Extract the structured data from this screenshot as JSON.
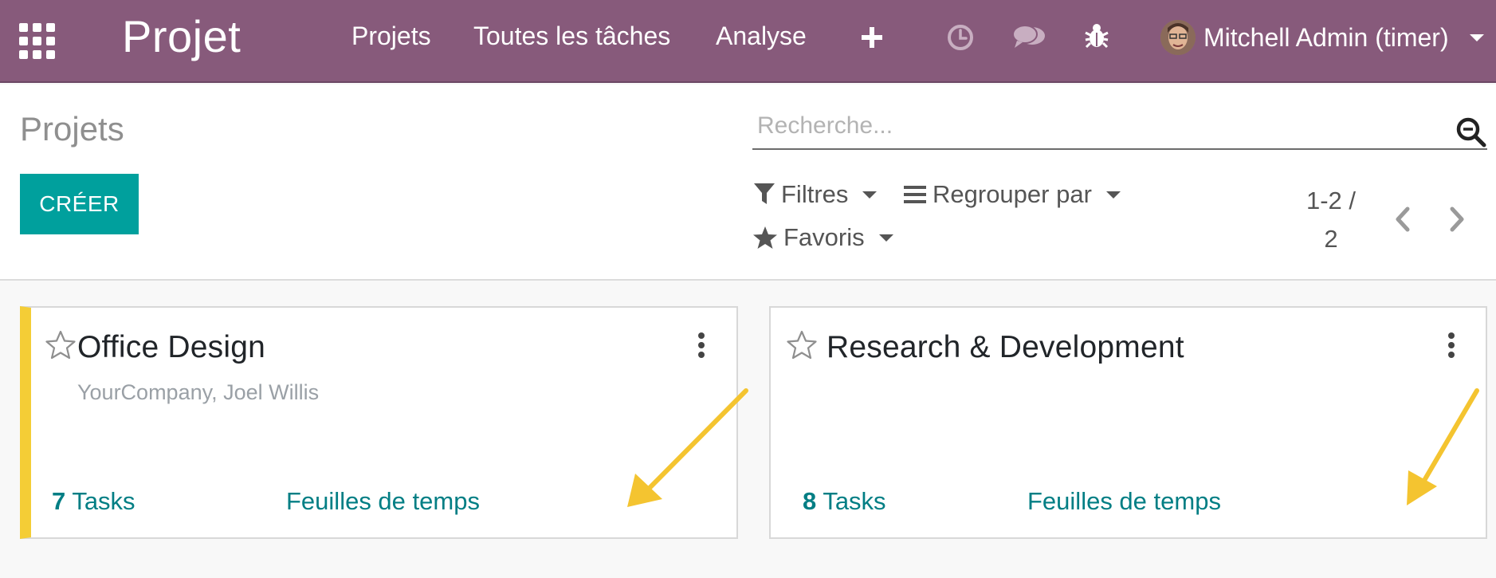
{
  "navbar": {
    "app_name": "Projet",
    "menu": [
      "Projets",
      "Toutes les tâches",
      "Analyse"
    ],
    "icons": [
      "apps-grid-icon",
      "plus-icon",
      "clock-icon",
      "chat-icon",
      "bug-icon",
      "chevron-down-icon"
    ],
    "user_name": "Mitchell Admin (timer)",
    "bg_color": "#875a7b"
  },
  "control_panel": {
    "breadcrumb": "Projets",
    "create_label": "CRÉER",
    "search_placeholder": "Recherche...",
    "filters_label": "Filtres",
    "groupby_label": "Regrouper par",
    "favorites_label": "Favoris",
    "pager_value": "1-2 /",
    "pager_total": "2",
    "accent_color": "#00a09d"
  },
  "projects": [
    {
      "name": "Office Design",
      "subtitle": "YourCompany, Joel Willis",
      "task_count": "7",
      "tasks_label": "Tasks",
      "timesheet_label": "Feuilles de temps",
      "color": "#f4cd36"
    },
    {
      "name": "Research & Development",
      "subtitle": "",
      "task_count": "8",
      "tasks_label": "Tasks",
      "timesheet_label": "Feuilles de temps",
      "color": ""
    }
  ],
  "annotation_color": "#f4c430"
}
